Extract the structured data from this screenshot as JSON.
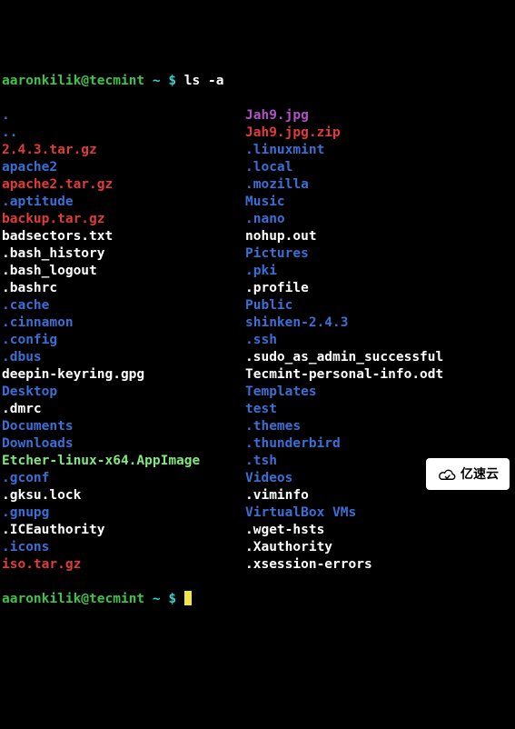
{
  "prompt": {
    "user": "aaronkilik@tecmint",
    "sep": " ~ $ ",
    "command": "ls -a"
  },
  "watermark": "亿速云",
  "rows": [
    {
      "c1": {
        "text": ".",
        "class": "blue"
      },
      "c2": {
        "text": "Jah9.jpg",
        "class": "magenta"
      }
    },
    {
      "c1": {
        "text": "..",
        "class": "blue"
      },
      "c2": {
        "text": "Jah9.jpg.zip",
        "class": "red"
      }
    },
    {
      "c1": {
        "text": "2.4.3.tar.gz",
        "class": "red"
      },
      "c2": {
        "text": ".linuxmint",
        "class": "blue"
      }
    },
    {
      "c1": {
        "text": "apache2",
        "class": "blue"
      },
      "c2": {
        "text": ".local",
        "class": "blue"
      }
    },
    {
      "c1": {
        "text": "apache2.tar.gz",
        "class": "red"
      },
      "c2": {
        "text": ".mozilla",
        "class": "blue"
      }
    },
    {
      "c1": {
        "text": ".aptitude",
        "class": "blue"
      },
      "c2": {
        "text": "Music",
        "class": "blue"
      }
    },
    {
      "c1": {
        "text": "backup.tar.gz",
        "class": "red"
      },
      "c2": {
        "text": ".nano",
        "class": "blue"
      }
    },
    {
      "c1": {
        "text": "badsectors.txt",
        "class": "white"
      },
      "c2": {
        "text": "nohup.out",
        "class": "white"
      }
    },
    {
      "c1": {
        "text": ".bash_history",
        "class": "white"
      },
      "c2": {
        "text": "Pictures",
        "class": "blue"
      }
    },
    {
      "c1": {
        "text": ".bash_logout",
        "class": "white"
      },
      "c2": {
        "text": ".pki",
        "class": "blue"
      }
    },
    {
      "c1": {
        "text": ".bashrc",
        "class": "white"
      },
      "c2": {
        "text": ".profile",
        "class": "white"
      }
    },
    {
      "c1": {
        "text": ".cache",
        "class": "blue"
      },
      "c2": {
        "text": "Public",
        "class": "blue"
      }
    },
    {
      "c1": {
        "text": ".cinnamon",
        "class": "blue"
      },
      "c2": {
        "text": "shinken-2.4.3",
        "class": "blue"
      }
    },
    {
      "c1": {
        "text": ".config",
        "class": "blue"
      },
      "c2": {
        "text": ".ssh",
        "class": "blue"
      }
    },
    {
      "c1": {
        "text": ".dbus",
        "class": "blue"
      },
      "c2": {
        "text": ".sudo_as_admin_successful",
        "class": "white"
      }
    },
    {
      "c1": {
        "text": "deepin-keyring.gpg",
        "class": "white"
      },
      "c2": {
        "text": "Tecmint-personal-info.odt",
        "class": "white"
      }
    },
    {
      "c1": {
        "text": "Desktop",
        "class": "blue"
      },
      "c2": {
        "text": "Templates",
        "class": "blue"
      }
    },
    {
      "c1": {
        "text": ".dmrc",
        "class": "white"
      },
      "c2": {
        "text": "test",
        "class": "blue"
      }
    },
    {
      "c1": {
        "text": "Documents",
        "class": "blue"
      },
      "c2": {
        "text": ".themes",
        "class": "blue"
      }
    },
    {
      "c1": {
        "text": "Downloads",
        "class": "blue"
      },
      "c2": {
        "text": ".thunderbird",
        "class": "blue"
      }
    },
    {
      "c1": {
        "text": "Etcher-linux-x64.AppImage",
        "class": "bgreen"
      },
      "c2": {
        "text": ".tsh",
        "class": "blue"
      }
    },
    {
      "c1": {
        "text": ".gconf",
        "class": "blue"
      },
      "c2": {
        "text": "Videos",
        "class": "blue"
      }
    },
    {
      "c1": {
        "text": ".gksu.lock",
        "class": "white"
      },
      "c2": {
        "text": ".viminfo",
        "class": "white"
      }
    },
    {
      "c1": {
        "text": ".gnupg",
        "class": "blue"
      },
      "c2": {
        "text": "VirtualBox VMs",
        "class": "blue"
      }
    },
    {
      "c1": {
        "text": ".ICEauthority",
        "class": "white"
      },
      "c2": {
        "text": ".wget-hsts",
        "class": "white"
      }
    },
    {
      "c1": {
        "text": ".icons",
        "class": "blue"
      },
      "c2": {
        "text": ".Xauthority",
        "class": "white"
      }
    },
    {
      "c1": {
        "text": "iso.tar.gz",
        "class": "red"
      },
      "c2": {
        "text": ".xsession-errors",
        "class": "white"
      }
    }
  ]
}
